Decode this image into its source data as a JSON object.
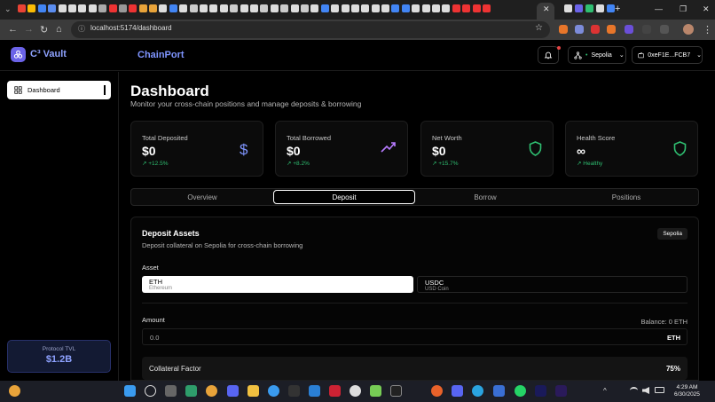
{
  "browser": {
    "url": "localhost:5174/dashboard",
    "tab_close": "✕",
    "new_tab": "+",
    "window_controls": [
      "—",
      "❐",
      "✕"
    ],
    "icons": [
      "tab-search-icon",
      "back-icon",
      "forward-icon",
      "reload-icon",
      "home-icon",
      "site-info-icon",
      "bookmark-star-icon"
    ]
  },
  "app": {
    "logo_text": "C³ Vault",
    "brand": "ChainPort",
    "network": "Sepolia",
    "wallet": "0xeF1E...FCB7",
    "accent": "#7f95ff"
  },
  "sidebar": {
    "items": [
      {
        "label": "Dashboard",
        "icon": "dashboard-grid-icon"
      }
    ],
    "tvl_label": "Protocol TVL",
    "tvl_value": "$1.2B"
  },
  "header": {
    "title": "Dashboard",
    "subtitle": "Monitor your cross-chain positions and manage deposits & borrowing"
  },
  "stats": [
    {
      "label": "Total Deposited",
      "value": "$0",
      "change": "+12.5%",
      "icon": "dollar-icon"
    },
    {
      "label": "Total Borrowed",
      "value": "$0",
      "change": "+8.2%",
      "icon": "trending-up-icon"
    },
    {
      "label": "Net Worth",
      "value": "$0",
      "change": "+15.7%",
      "icon": "shield-icon"
    },
    {
      "label": "Health Score",
      "value": "∞",
      "change": "Healthy",
      "icon": "shield-icon"
    }
  ],
  "tabs": [
    "Overview",
    "Deposit",
    "Borrow",
    "Positions"
  ],
  "active_tab": "Deposit",
  "deposit": {
    "title": "Deposit Assets",
    "subtitle": "Deposit collateral on Sepolia for cross-chain borrowing",
    "chain_chip": "Sepolia",
    "asset_label": "Asset",
    "assets": [
      {
        "symbol": "ETH",
        "name": "Ethereum",
        "selected": true
      },
      {
        "symbol": "USDC",
        "name": "USD Coin",
        "selected": false
      }
    ],
    "amount_label": "Amount",
    "balance": "Balance: 0 ETH",
    "amount_value": "0.0",
    "amount_unit": "ETH",
    "collateral_label": "Collateral Factor",
    "collateral_value": "75%"
  },
  "taskbar": {
    "time": "4:29 AM",
    "date": "6/30/2025",
    "chevron": "^",
    "tray_icons": [
      "wifi-icon",
      "volume-icon",
      "battery-icon"
    ]
  }
}
